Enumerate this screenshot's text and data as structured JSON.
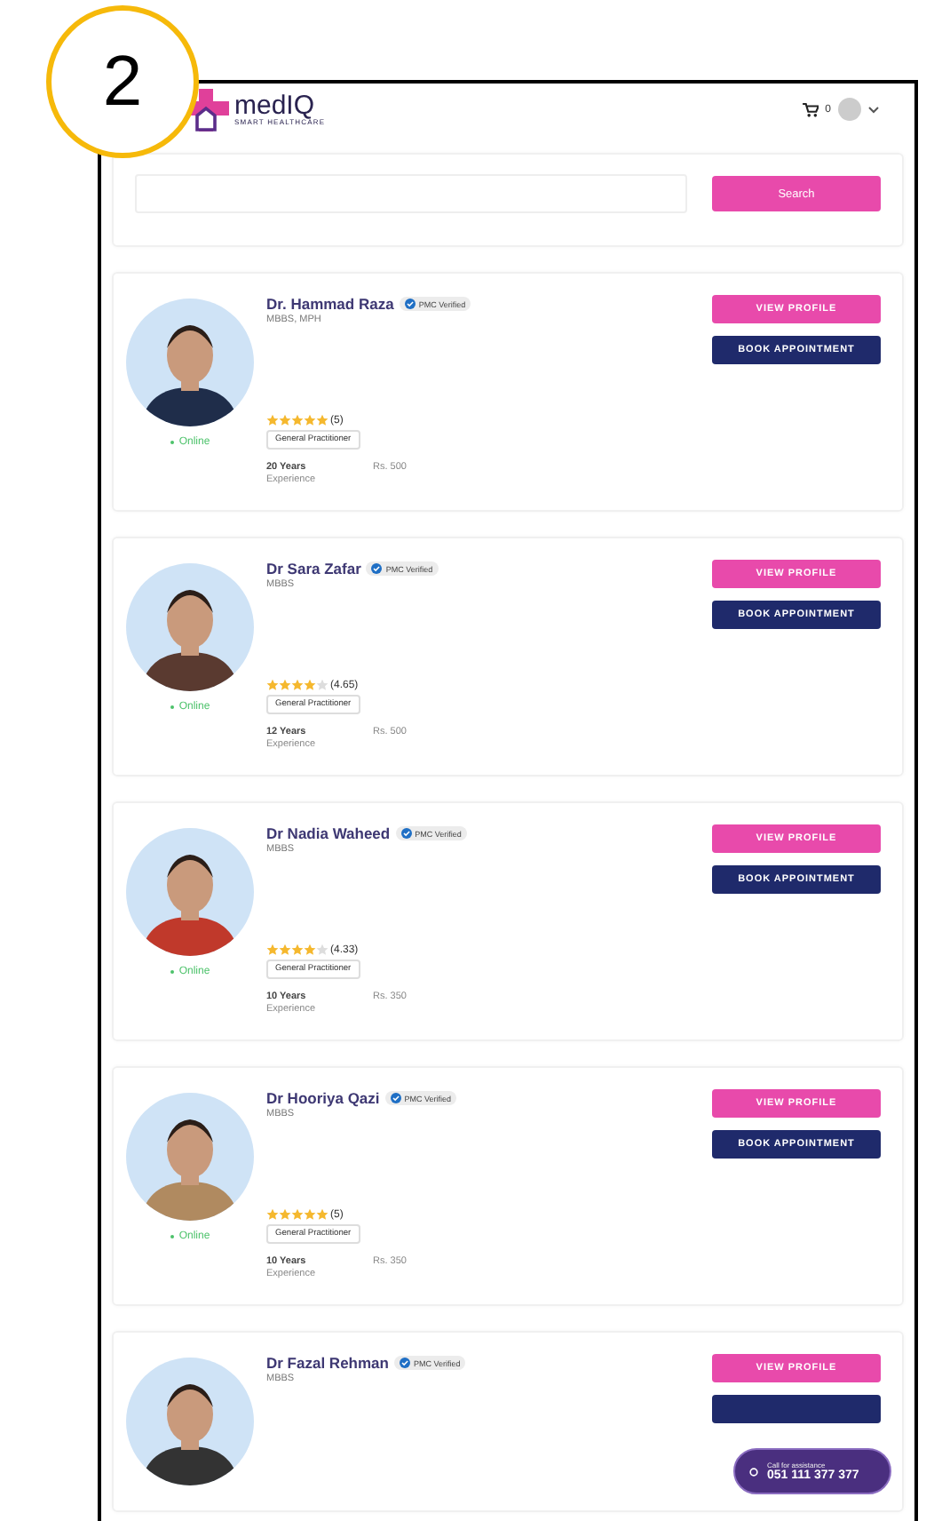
{
  "callout": {
    "number": "2"
  },
  "header": {
    "logo": {
      "name": "medIQ",
      "tagline": "SMART HEALTHCARE"
    },
    "cart_count": "0"
  },
  "search": {
    "button": "Search"
  },
  "doctors": [
    {
      "name": "Dr. Hammad Raza",
      "badge": "PMC Verified",
      "degree": "MBBS, MPH",
      "status": "Online",
      "stars": 5,
      "rating": "(5)",
      "specialty": "General Practitioner",
      "years": "20 Years",
      "experience_label": "Experience",
      "fee": "Rs. 500",
      "buttons": [
        {
          "kind": "view",
          "label": "VIEW PROFILE"
        },
        {
          "kind": "book",
          "label": "BOOK APPOINTMENT"
        }
      ]
    },
    {
      "name": "Dr Sara Zafar",
      "badge": "PMC Verified",
      "degree": "MBBS",
      "status": "Online",
      "stars": 4,
      "rating": "(4.65)",
      "specialty": "General Practitioner",
      "years": "12 Years",
      "experience_label": "Experience",
      "fee": "Rs. 500",
      "buttons": [
        {
          "kind": "view",
          "label": "VIEW PROFILE"
        },
        {
          "kind": "book",
          "label": "BOOK APPOINTMENT"
        }
      ]
    },
    {
      "name": "Dr Nadia Waheed",
      "badge": "PMC Verified",
      "degree": "MBBS",
      "status": "Online",
      "stars": 4,
      "rating": "(4.33)",
      "specialty": "General Practitioner",
      "years": "10 Years",
      "experience_label": "Experience",
      "fee": "Rs. 350",
      "buttons": [
        {
          "kind": "view",
          "label": "VIEW PROFILE"
        },
        {
          "kind": "book",
          "label": "BOOK APPOINTMENT"
        }
      ]
    },
    {
      "name": "Dr Hooriya Qazi",
      "badge": "PMC Verified",
      "degree": "MBBS",
      "status": "Online",
      "stars": 5,
      "rating": "(5)",
      "specialty": "General Practitioner",
      "years": "10 Years",
      "experience_label": "Experience",
      "fee": "Rs. 350",
      "buttons": [
        {
          "kind": "view",
          "label": "VIEW PROFILE"
        },
        {
          "kind": "book",
          "label": "BOOK APPOINTMENT"
        }
      ]
    },
    {
      "name": "Dr Fazal Rehman",
      "badge": "PMC Verified",
      "degree": "MBBS",
      "buttons": [
        {
          "kind": "view",
          "label": "VIEW PROFILE"
        },
        {
          "kind": "book"
        }
      ]
    }
  ],
  "assistance": {
    "label": "Call for assistance",
    "phone": "051 111 377 377"
  }
}
